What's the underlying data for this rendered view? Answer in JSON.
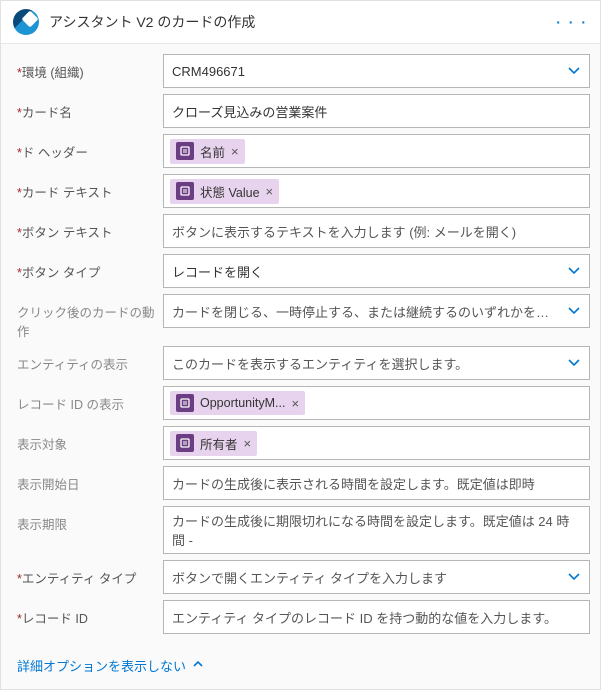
{
  "header": {
    "title": "アシスタント V2 のカードの作成",
    "more_label": "· · ·"
  },
  "fields": {
    "environment": {
      "label": "環境 (組織)",
      "required": true,
      "value": "CRM496671"
    },
    "card_name": {
      "label": "カード名",
      "required": true,
      "value": "クローズ見込みの営業案件"
    },
    "card_header": {
      "label": "ド ヘッダー",
      "required": true,
      "token": "名前"
    },
    "card_text": {
      "label": "カード テキスト",
      "required": true,
      "token": "状態 Value"
    },
    "button_text": {
      "label": "ボタン テキスト",
      "required": true,
      "placeholder": "ボタンに表示するテキストを入力します (例: メールを開く)"
    },
    "button_type": {
      "label": "ボタン タイプ",
      "required": true,
      "value": "レコードを開く"
    },
    "post_click": {
      "label": "クリック後のカードの動作",
      "required": false,
      "placeholder": "カードを閉じる、一時停止する、または継続するのいずれかを選択してください。"
    },
    "entity_display": {
      "label": "エンティティの表示",
      "required": false,
      "placeholder": "このカードを表示するエンティティを選択します。"
    },
    "record_id_display": {
      "label": "レコード ID の表示",
      "required": false,
      "token": "OpportunityM..."
    },
    "display_target": {
      "label": "表示対象",
      "required": false,
      "token": "所有者"
    },
    "start_date": {
      "label": "表示開始日",
      "required": false,
      "placeholder": "カードの生成後に表示される時間を設定します。既定値は即時"
    },
    "expiry": {
      "label": "表示期限",
      "required": false,
      "placeholder": "カードの生成後に期限切れになる時間を設定します。既定値は 24 時間 -"
    },
    "entity_type": {
      "label": "エンティティ タイプ",
      "required": true,
      "placeholder": "ボタンで開くエンティティ タイプを入力します"
    },
    "record_id": {
      "label": "レコード ID",
      "required": true,
      "placeholder": "エンティティ タイプのレコード ID を持つ動的な値を入力します。"
    }
  },
  "footer": {
    "advanced_toggle": "詳細オプションを表示しない"
  }
}
